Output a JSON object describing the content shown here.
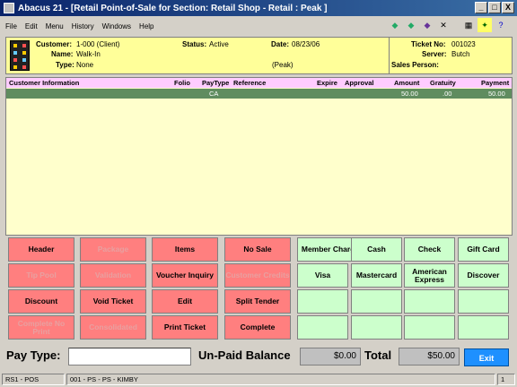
{
  "window": {
    "title": "Abacus 21 - [Retail Point-of-Sale for Section: Retail Shop - Retail : Peak ]",
    "controls": [
      "_",
      "□",
      "X"
    ]
  },
  "menu": [
    "File",
    "Edit",
    "Menu",
    "History",
    "Windows",
    "Help"
  ],
  "toolbar_icons": [
    "arrow-left-icon",
    "arrow-right-icon",
    "gem-icon",
    "tool-icon",
    "calculator-icon",
    "runner-icon",
    "help-icon"
  ],
  "header": {
    "customer_label": "Customer:",
    "customer": "1-000 (Client)",
    "name_label": "Name:",
    "name": "Walk-In",
    "type_label": "Type:",
    "type": "None",
    "status_label": "Status:",
    "status": "Active",
    "date_label": "Date:",
    "date": "08/23/06",
    "period": "(Peak)",
    "ticket_label": "Ticket No:",
    "ticket": "001023",
    "server_label": "Server:",
    "server": "Butch",
    "salesperson_label": "Sales Person:",
    "salesperson": ""
  },
  "grid": {
    "columns": [
      "Customer Information",
      "Folio",
      "PayType",
      "Reference",
      "Expire",
      "Approval",
      "Amount",
      "Gratuity",
      "Payment"
    ],
    "rows": [
      {
        "customer": "",
        "folio": "",
        "paytype": "CA",
        "reference": "",
        "expire": "",
        "approval": "",
        "amount": "50.00",
        "gratuity": ".00",
        "payment": "50.00"
      }
    ]
  },
  "buttons": {
    "red": [
      [
        "Header",
        "Package",
        "Items",
        "No Sale"
      ],
      [
        "Tip Pool",
        "Validation",
        "Voucher Inquiry",
        "Customer Credits"
      ],
      [
        "Discount",
        "Void Ticket",
        "Edit",
        "Split Tender"
      ],
      [
        "Complete No Print",
        "Consolidated",
        "Print Ticket",
        "Complete"
      ]
    ],
    "green": [
      [
        "Member Charge",
        "Cash",
        "Check",
        "Gift Card"
      ],
      [
        "Visa",
        "Mastercard",
        "American Express",
        "Discover"
      ],
      [
        "",
        "",
        "",
        ""
      ],
      [
        "",
        "",
        "",
        ""
      ]
    ]
  },
  "bottom": {
    "pay_type_label": "Pay Type:",
    "pay_type_value": "",
    "unpaid_label": "Un-Paid Balance",
    "unpaid_value": "$0.00",
    "total_label": "Total",
    "total_value": "$50.00",
    "exit_label": "Exit"
  },
  "status": {
    "left": "RS1 - POS",
    "middle": "001 - PS - PS - KIMBY",
    "right": "1"
  },
  "colors": {
    "red_button": "#ff7f7f",
    "green_button": "#ccffcc",
    "grid_row": "#5f8c5f",
    "header_bg": "#ffff99"
  }
}
